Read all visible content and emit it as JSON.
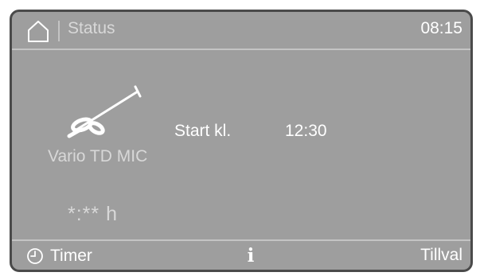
{
  "header": {
    "home_icon": "home-icon",
    "title": "Status",
    "time": "08:15"
  },
  "program": {
    "icon": "instrument-icon",
    "name": "Vario TD MIC"
  },
  "start": {
    "label": "Start kl.",
    "time": "12:30"
  },
  "remaining_time": "*:** h",
  "footer": {
    "timer_icon": "clock-icon",
    "timer_label": "Timer",
    "info_icon": "info-icon",
    "info_glyph": "i",
    "options_label": "Tillval"
  },
  "colors": {
    "screen_bg": "#9e9e9e",
    "text": "#ffffff",
    "dim_text": "#d8d8d8"
  }
}
